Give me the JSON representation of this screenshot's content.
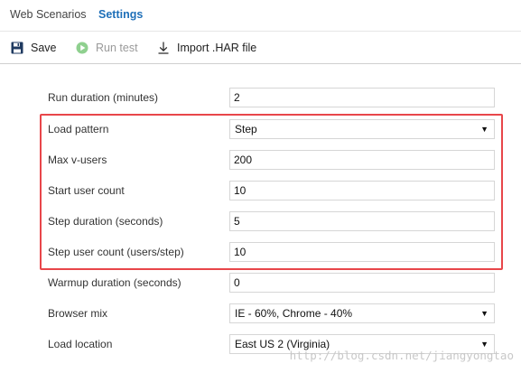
{
  "tabs": [
    {
      "label": "Web Scenarios",
      "active": false
    },
    {
      "label": "Settings",
      "active": true
    }
  ],
  "toolbar": {
    "save_label": "Save",
    "run_test_label": "Run test",
    "import_label": "Import .HAR file"
  },
  "form": {
    "run_duration": {
      "label": "Run duration (minutes)",
      "value": "2"
    },
    "load_pattern": {
      "label": "Load pattern",
      "value": "Step"
    },
    "max_vusers": {
      "label": "Max v-users",
      "value": "200"
    },
    "start_user_count": {
      "label": "Start user count",
      "value": "10"
    },
    "step_duration": {
      "label": "Step duration (seconds)",
      "value": "5"
    },
    "step_user_count": {
      "label": "Step user count (users/step)",
      "value": "10"
    },
    "warmup_duration": {
      "label": "Warmup duration (seconds)",
      "value": "0"
    },
    "browser_mix": {
      "label": "Browser mix",
      "value": "IE - 60%, Chrome - 40%"
    },
    "load_location": {
      "label": "Load location",
      "value": "East US 2 (Virginia)"
    }
  },
  "watermark": "http://blog.csdn.net/jiangyongtao",
  "colors": {
    "active_tab": "#1e6fb8",
    "highlight_border": "#e8464a",
    "run_icon": "#5cb85c",
    "save_icon": "#1f3a60"
  },
  "icons": {
    "save": "floppy-disk-icon",
    "run": "play-circle-icon",
    "import": "download-arrow-icon",
    "dropdown": "triangle-down-icon"
  }
}
